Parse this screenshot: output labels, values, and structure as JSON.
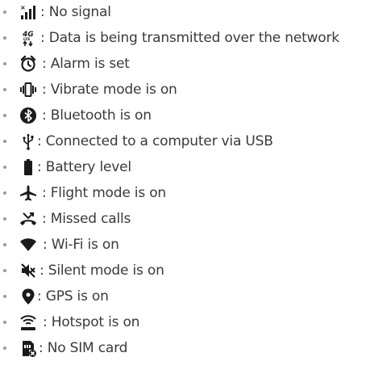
{
  "items": [
    {
      "icon": "no-signal-icon",
      "text": ": No signal"
    },
    {
      "icon": "data-transfer-icon",
      "text": ": Data is being transmitted over the network"
    },
    {
      "icon": "alarm-clock-icon",
      "text": ": Alarm is set"
    },
    {
      "icon": "vibrate-icon",
      "text": ": Vibrate mode is on"
    },
    {
      "icon": "bluetooth-icon",
      "text": ": Bluetooth is on"
    },
    {
      "icon": "usb-icon",
      "text": ": Connected to a computer via USB"
    },
    {
      "icon": "battery-icon",
      "text": ": Battery level"
    },
    {
      "icon": "airplane-icon",
      "text": ": Flight mode is on"
    },
    {
      "icon": "missed-call-icon",
      "text": ": Missed calls"
    },
    {
      "icon": "wifi-icon",
      "text": ": Wi-Fi is on"
    },
    {
      "icon": "silent-mode-icon",
      "text": ": Silent mode is on"
    },
    {
      "icon": "gps-pin-icon",
      "text": ": GPS is on"
    },
    {
      "icon": "hotspot-icon",
      "text": ": Hotspot is on"
    },
    {
      "icon": "no-sim-icon",
      "text": ": No SIM card"
    }
  ]
}
